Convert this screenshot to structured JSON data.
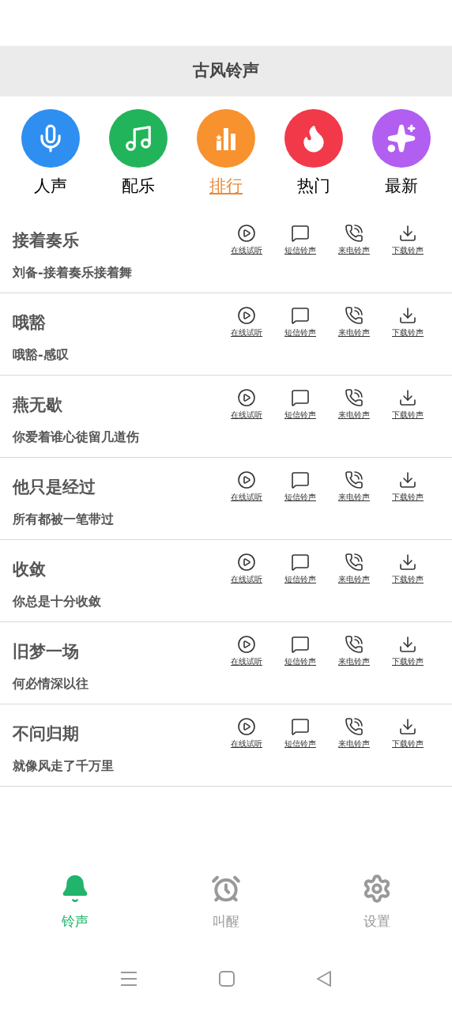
{
  "header": {
    "title": "古风铃声"
  },
  "categories": [
    {
      "label": "人声",
      "kind": "mic",
      "color": "#2f8ff0",
      "selected": false
    },
    {
      "label": "配乐",
      "kind": "note",
      "color": "#22b45a",
      "selected": false
    },
    {
      "label": "排行",
      "kind": "chart",
      "color": "#f7922f",
      "selected": true
    },
    {
      "label": "热门",
      "kind": "flame",
      "color": "#f1394a",
      "selected": false
    },
    {
      "label": "最新",
      "kind": "sparkle",
      "color": "#b25ef0",
      "selected": false
    }
  ],
  "songs": [
    {
      "title": "接着奏乐",
      "subtitle": "刘备-接着奏乐接着舞",
      "actions": [
        {
          "kind": "play",
          "label": "在线试听"
        },
        {
          "kind": "sms",
          "label": "短信铃声"
        },
        {
          "kind": "call",
          "label": "来电铃声"
        },
        {
          "kind": "download",
          "label": "下载铃声"
        }
      ]
    },
    {
      "title": "哦豁",
      "subtitle": "哦豁-感叹",
      "actions": [
        {
          "kind": "play",
          "label": "在线试听"
        },
        {
          "kind": "sms",
          "label": "短信铃声"
        },
        {
          "kind": "call",
          "label": "来电铃声"
        },
        {
          "kind": "download",
          "label": "下载铃声"
        }
      ]
    },
    {
      "title": "燕无歇",
      "subtitle": "你爱着谁心徒留几道伤",
      "actions": [
        {
          "kind": "play",
          "label": "在线试听"
        },
        {
          "kind": "sms",
          "label": "短信铃声"
        },
        {
          "kind": "call",
          "label": "来电铃声"
        },
        {
          "kind": "download",
          "label": "下载铃声"
        }
      ]
    },
    {
      "title": "他只是经过",
      "subtitle": "所有都被一笔带过",
      "actions": [
        {
          "kind": "play",
          "label": "在线试听"
        },
        {
          "kind": "sms",
          "label": "短信铃声"
        },
        {
          "kind": "call",
          "label": "来电铃声"
        },
        {
          "kind": "download",
          "label": "下载铃声"
        }
      ]
    },
    {
      "title": "收敛",
      "subtitle": "你总是十分收敛",
      "actions": [
        {
          "kind": "play",
          "label": "在线试听"
        },
        {
          "kind": "sms",
          "label": "短信铃声"
        },
        {
          "kind": "call",
          "label": "来电铃声"
        },
        {
          "kind": "download",
          "label": "下载铃声"
        }
      ]
    },
    {
      "title": "旧梦一场",
      "subtitle": "何必情深以往",
      "actions": [
        {
          "kind": "play",
          "label": "在线试听"
        },
        {
          "kind": "sms",
          "label": "短信铃声"
        },
        {
          "kind": "call",
          "label": "来电铃声"
        },
        {
          "kind": "download",
          "label": "下载铃声"
        }
      ]
    },
    {
      "title": "不问归期",
      "subtitle": "就像风走了千万里",
      "actions": [
        {
          "kind": "play",
          "label": "在线试听"
        },
        {
          "kind": "sms",
          "label": "短信铃声"
        },
        {
          "kind": "call",
          "label": "来电铃声"
        },
        {
          "kind": "download",
          "label": "下载铃声"
        }
      ]
    }
  ],
  "bottom_nav": [
    {
      "label": "铃声",
      "kind": "bell",
      "selected": true
    },
    {
      "label": "叫醒",
      "kind": "alarm",
      "selected": false
    },
    {
      "label": "设置",
      "kind": "gear",
      "selected": false
    }
  ],
  "system_nav": [
    {
      "kind": "menu"
    },
    {
      "kind": "home"
    },
    {
      "kind": "back"
    }
  ]
}
